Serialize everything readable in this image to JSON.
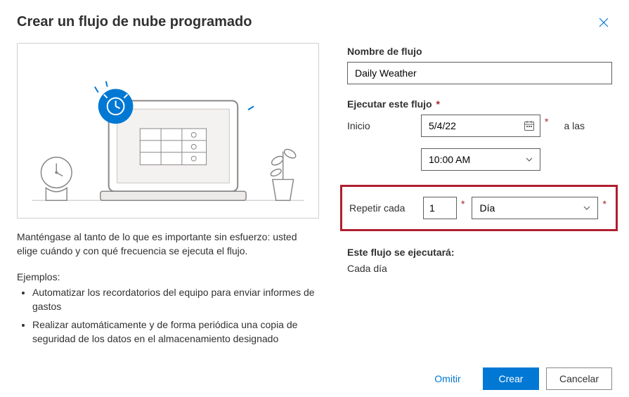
{
  "title": "Crear un flujo de nube programado",
  "description": "Manténgase al tanto de lo que es importante sin esfuerzo: usted elige cuándo y con qué frecuencia se ejecuta el flujo.",
  "examples_label": "Ejemplos:",
  "examples": [
    "Automatizar los recordatorios del equipo para enviar informes de gastos",
    "Realizar automáticamente y de forma periódica una copia de seguridad de los datos en el almacenamiento designado"
  ],
  "form": {
    "flow_name_label": "Nombre de flujo",
    "flow_name_value": "Daily Weather",
    "run_label": "Ejecutar este flujo",
    "start_label": "Inicio",
    "start_date": "5/4/22",
    "at_label": "a las",
    "start_time": "10:00 AM",
    "repeat_label": "Repetir cada",
    "repeat_value": "1",
    "repeat_unit": "Día",
    "summary_label": "Este flujo se ejecutará:",
    "summary_text": "Cada día"
  },
  "footer": {
    "skip": "Omitir",
    "create": "Crear",
    "cancel": "Cancelar"
  }
}
